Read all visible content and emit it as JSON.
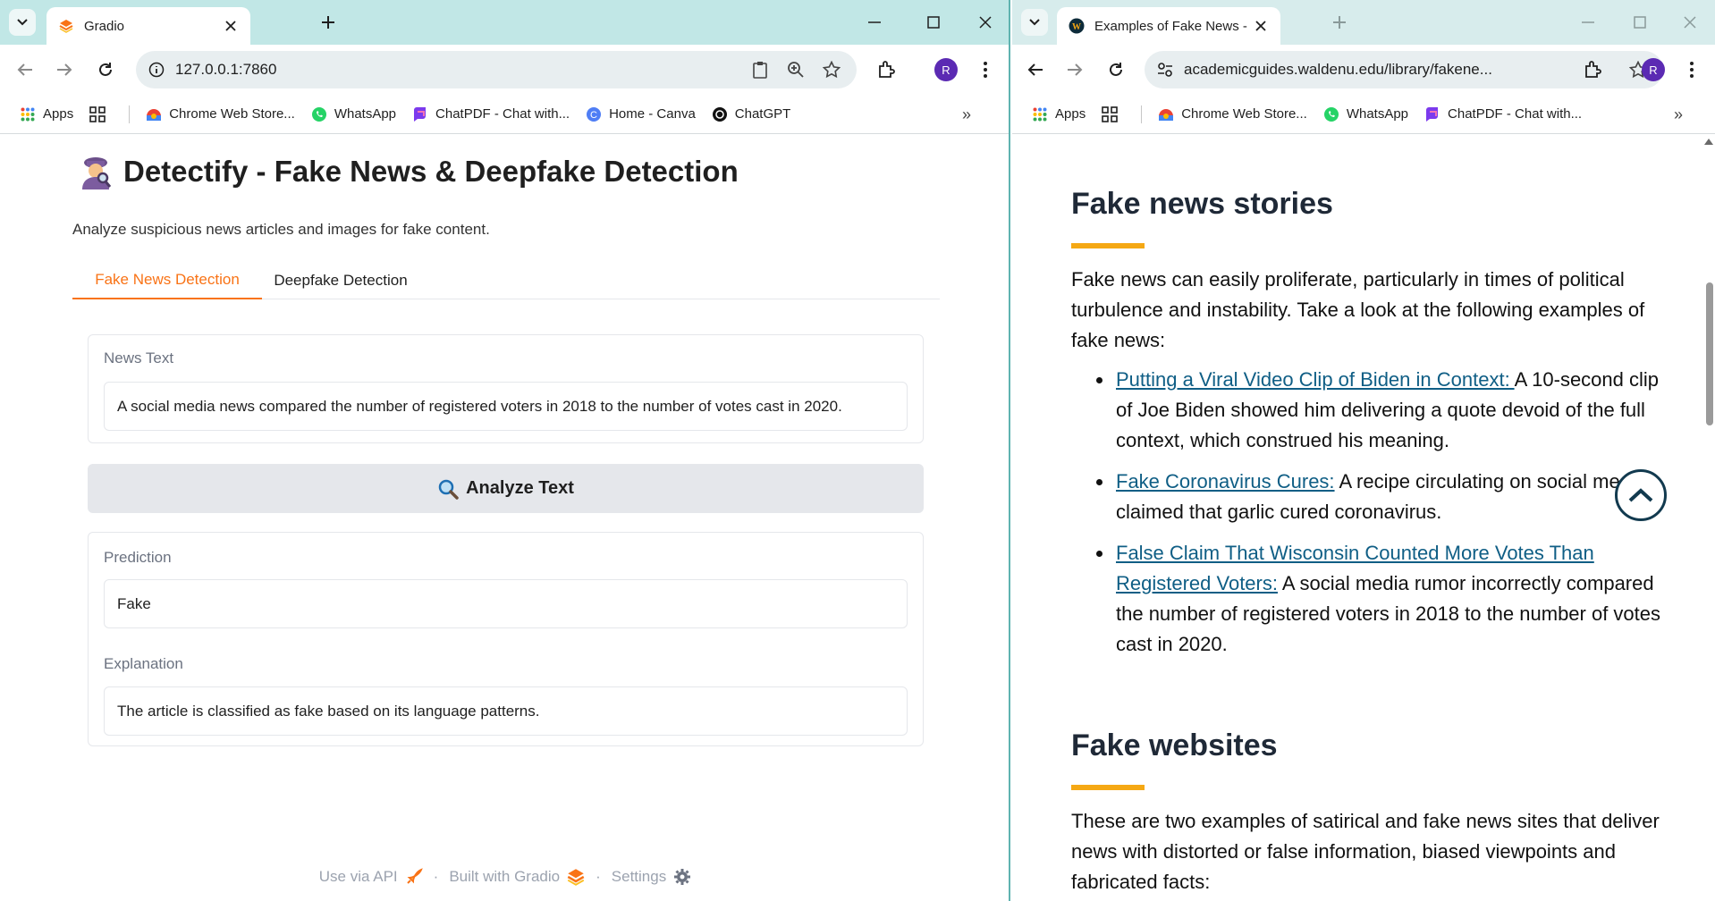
{
  "left_window": {
    "tab_title": "Gradio",
    "url": "127.0.0.1:7860",
    "profile_initial": "R",
    "bookmarks": [
      "Apps",
      "Chrome Web Store...",
      "WhatsApp",
      "ChatPDF - Chat with...",
      "Home - Canva",
      "ChatGPT"
    ],
    "bookmarks_more": "»"
  },
  "right_window": {
    "tab_title": "Examples of Fake News - Fact C",
    "url": "academicguides.waldenu.edu/library/fakene...",
    "profile_initial": "R",
    "bookmarks": [
      "Apps",
      "Chrome Web Store...",
      "WhatsApp",
      "ChatPDF - Chat with..."
    ],
    "bookmarks_more": "»"
  },
  "app": {
    "title": "Detectify - Fake News & Deepfake Detection",
    "subtitle": "Analyze suspicious news articles and images for fake content.",
    "tabs": [
      "Fake News Detection",
      "Deepfake Detection"
    ],
    "news_label": "News Text",
    "news_value": "A social media news compared the number of registered voters in 2018 to the number of votes cast in 2020.",
    "analyze_button": "Analyze Text",
    "prediction_label": "Prediction",
    "prediction_value": "Fake",
    "explanation_label": "Explanation",
    "explanation_value": "The article is classified as fake based on its language patterns.",
    "footer": {
      "api": "Use via API",
      "built": "Built with Gradio",
      "settings": "Settings",
      "separator": "·"
    }
  },
  "article": {
    "heading1": "Fake news stories",
    "intro": "Fake news can easily proliferate, particularly in times of political turbulence and instability. Take a look at the following examples of fake news:",
    "items": [
      {
        "link": "Putting a Viral Video Clip of Biden in Context: ",
        "text": "A 10-second clip of Joe Biden showed him delivering a quote devoid of the full context, which construed his meaning."
      },
      {
        "link": "Fake Coronavirus Cures:",
        "text": " A recipe circulating on social media claimed that garlic cured coronavirus."
      },
      {
        "link": "False Claim That Wisconsin Counted More Votes Than Registered Voters:",
        "text": " A social media rumor incorrectly compared the number of registered voters in 2018 to the number of votes cast in 2020."
      }
    ],
    "heading2": "Fake websites",
    "outro": "These are two examples of satirical and fake news sites that deliver news with distorted or false information, biased viewpoints and fabricated facts:"
  },
  "colors": {
    "accent_orange": "#f97316",
    "link_blue": "#0f5e85",
    "heading_bar": "#f5a814",
    "tabstrip_left": "#c1e7e6",
    "tabstrip_right": "#d7ecec"
  }
}
